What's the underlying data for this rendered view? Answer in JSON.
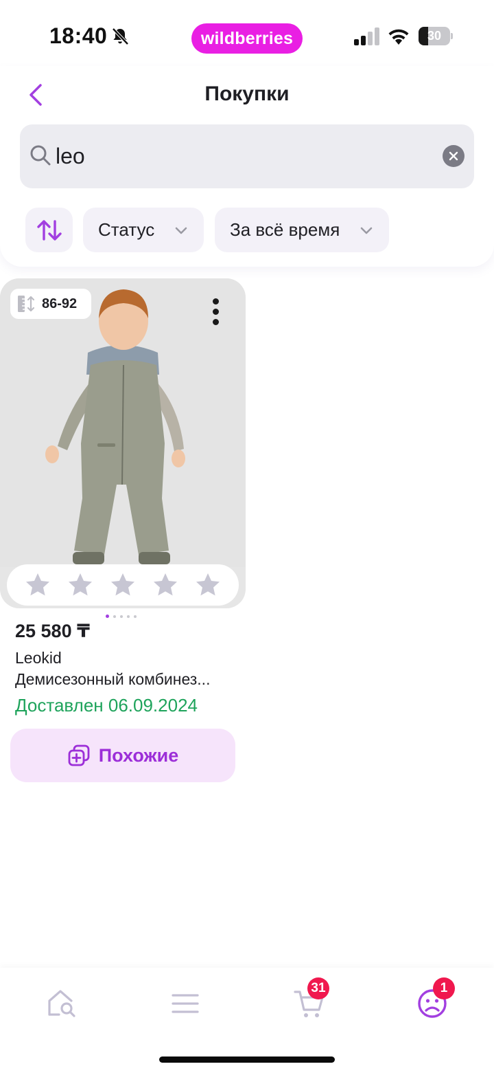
{
  "status_bar": {
    "time": "18:40",
    "brand": "wildberries",
    "battery_level": "30",
    "battery_fraction": 0.3
  },
  "header": {
    "title": "Покупки",
    "search": {
      "value": "leo",
      "placeholder": ""
    },
    "filters": {
      "status_label": "Статус",
      "period_label": "За всё время"
    }
  },
  "product": {
    "size": "86-92",
    "price": "25 580 ₸",
    "brand": "Leokid",
    "name": "Демисезонный комбинез...",
    "delivery_status": "Доставлен 06.09.2024",
    "similar_label": "Похожие",
    "rating_stars": 5,
    "rating_value": 0,
    "image_pages": 5,
    "image_page_current": 1
  },
  "bottom_nav": {
    "items": [
      {
        "icon": "home-search-icon"
      },
      {
        "icon": "menu-icon"
      },
      {
        "icon": "cart-icon",
        "badge": "31"
      },
      {
        "icon": "profile-icon",
        "badge": "1"
      }
    ]
  },
  "colors": {
    "brand_accent": "#e91fe3",
    "purple": "#a23fe0",
    "delivered_green": "#1ea35b",
    "badge_red": "#f0184e"
  }
}
